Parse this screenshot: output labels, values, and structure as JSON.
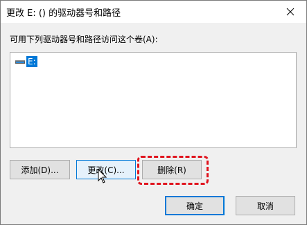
{
  "window": {
    "title": "更改 E: () 的驱动器号和路径"
  },
  "content": {
    "prompt": "可用下列驱动器号和路径访问这个卷(A):",
    "list_items": [
      {
        "label": "E:",
        "selected": true,
        "icon": "drive-icon"
      }
    ]
  },
  "buttons": {
    "add": "添加(D)...",
    "change": "更改(C)...",
    "delete": "删除(R)",
    "ok": "确定",
    "cancel": "取消"
  },
  "annotation": {
    "highlight_color": "#e0141e",
    "highlighted_button": "delete"
  },
  "colors": {
    "selection": "#0078d7",
    "dialog_bg": "#f0f0f0"
  }
}
